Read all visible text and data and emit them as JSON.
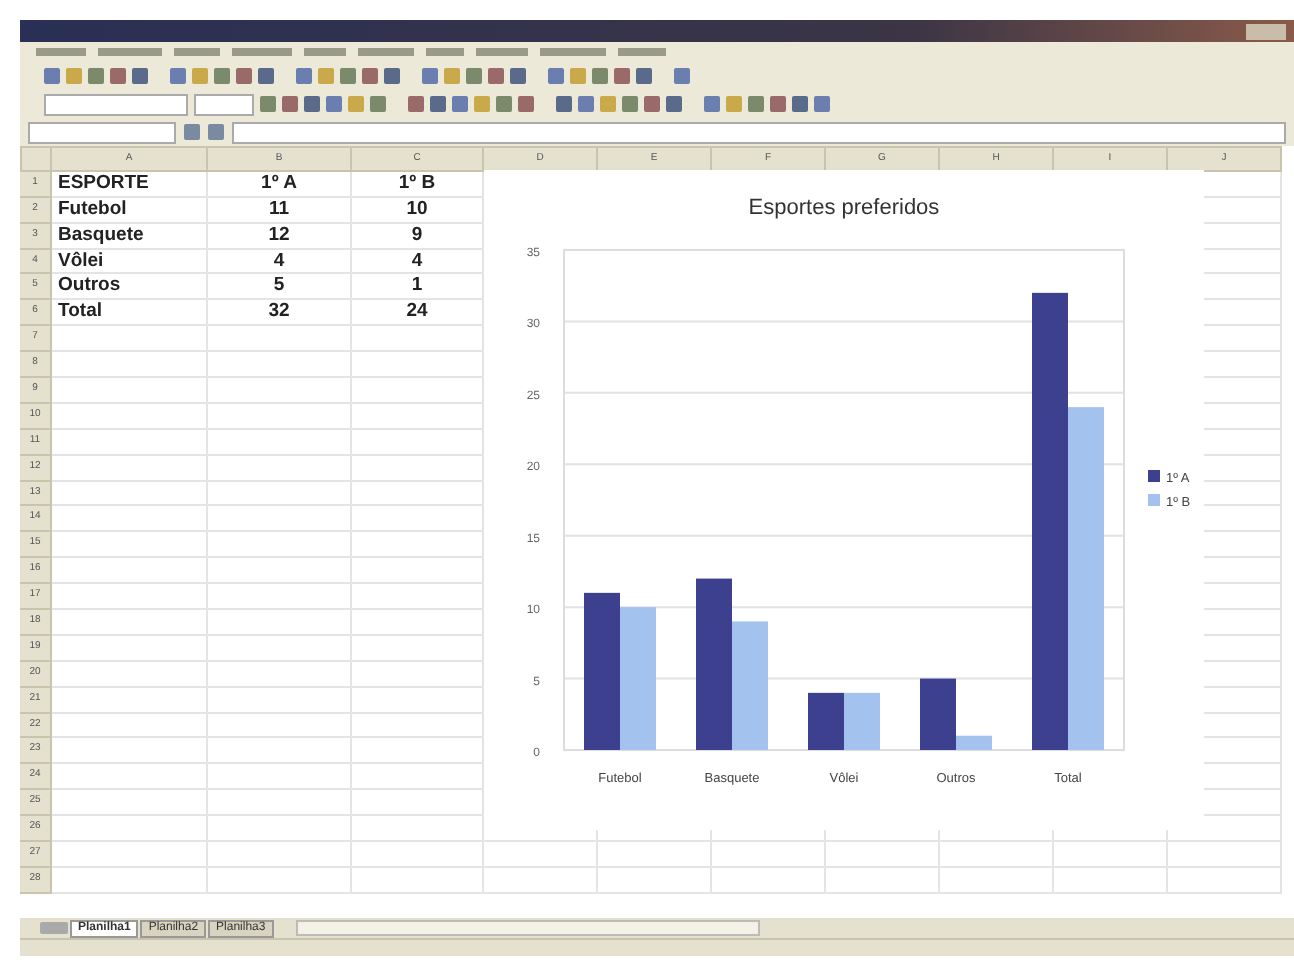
{
  "columns": [
    "A",
    "B",
    "C",
    "D",
    "E",
    "F",
    "G",
    "H",
    "I",
    "J"
  ],
  "rows": [
    [
      "ESPORTE",
      "1º A",
      "1º B"
    ],
    [
      "Futebol",
      "11",
      "10"
    ],
    [
      "Basquete",
      "12",
      "9"
    ],
    [
      "Vôlei",
      "4",
      "4"
    ],
    [
      "Outros",
      "5",
      "1"
    ],
    [
      "Total",
      "32",
      "24"
    ]
  ],
  "row_numbers": [
    "1",
    "2",
    "3",
    "4",
    "5",
    "6",
    "7",
    "8",
    "9",
    "10",
    "11",
    "12",
    "13",
    "14",
    "15",
    "16",
    "17",
    "18",
    "19",
    "20",
    "21",
    "22",
    "23",
    "24",
    "25",
    "26",
    "27",
    "28"
  ],
  "chart_data": {
    "type": "bar",
    "title": "Esportes preferidos",
    "categories": [
      "Futebol",
      "Basquete",
      "Vôlei",
      "Outros",
      "Total"
    ],
    "series": [
      {
        "name": "1º A",
        "color": "#3d3f8f",
        "values": [
          11,
          12,
          4,
          5,
          32
        ]
      },
      {
        "name": "1º B",
        "color": "#a4c2ee",
        "values": [
          10,
          9,
          4,
          1,
          24
        ]
      }
    ],
    "ylim": [
      0,
      35
    ],
    "yticks": [
      0,
      5,
      10,
      15,
      20,
      25,
      30,
      35
    ],
    "grid": true,
    "legend": true
  },
  "sheet_tabs": [
    {
      "label": "Planilha1",
      "selected": true
    },
    {
      "label": "Planilha2",
      "selected": false
    },
    {
      "label": "Planilha3",
      "selected": false
    }
  ]
}
